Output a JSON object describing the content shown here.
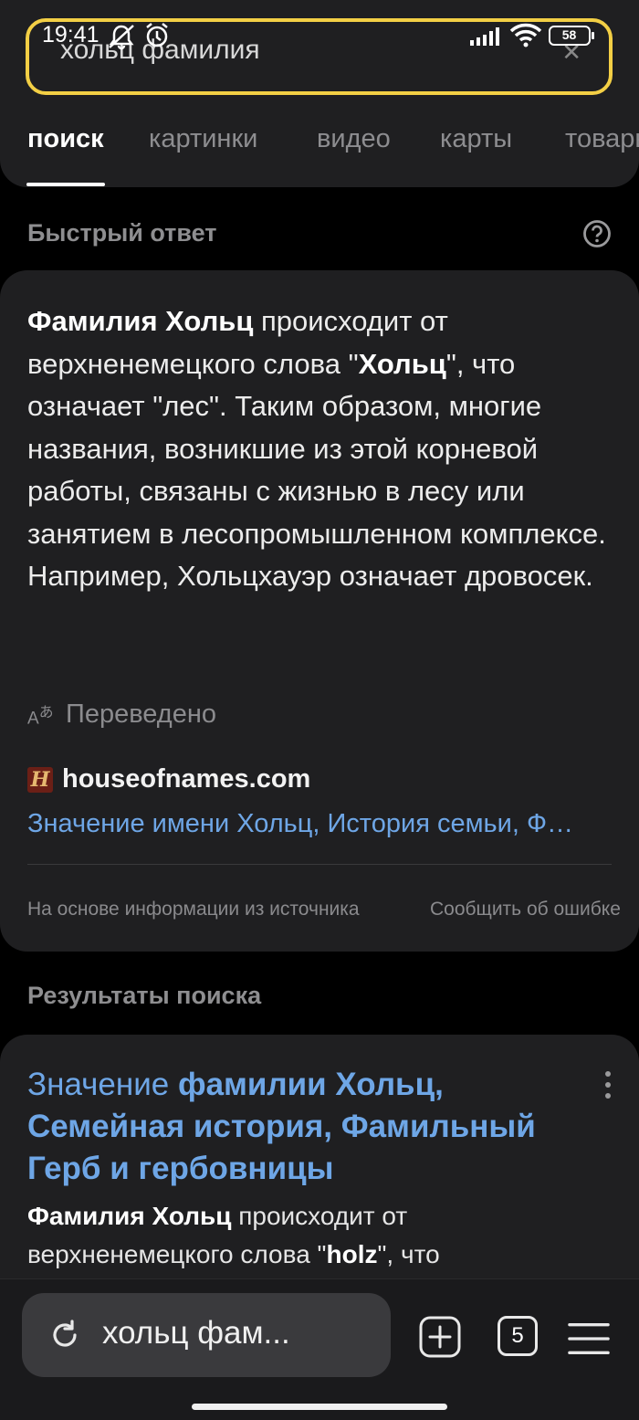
{
  "status_bar": {
    "time": "19:41",
    "battery": "58",
    "icons": [
      "mute-icon",
      "alarm-icon",
      "signal-icon",
      "wifi-icon",
      "battery-icon"
    ]
  },
  "search": {
    "query": "хольц фамилия"
  },
  "tabs": [
    {
      "label": "поиск",
      "active": true
    },
    {
      "label": "картинки"
    },
    {
      "label": "видео"
    },
    {
      "label": "карты"
    },
    {
      "label": "товары"
    }
  ],
  "quick_answer": {
    "title": "Быстрый ответ",
    "text_parts": {
      "p1_bold": "Фамилия Хольц",
      "p1_rest": " происходит от верхненемецкого слова \"",
      "p2_bold": "Хольц",
      "p2_rest": "\", что означает \"лес\". Таким образом, многие названия, возникшие из этой корневой работы, связаны с жизнью в лесу или занятием в лесопромышленном комплексе. Например, Хольцхауэр означает дровосек."
    },
    "translated_label": "Переведено",
    "source_favicon_letter": "H",
    "source_domain": "houseofnames.com",
    "source_link": "Значение имени Хольц, История семьи, Ф…",
    "footer_left": "На основе информации из источника",
    "footer_right": "Сообщить об ошибке"
  },
  "results": {
    "title": "Результаты поиска",
    "items": [
      {
        "title_part1": "Значение ",
        "title_part2": "фамилии Хольц",
        "title_part3": ", Семейная история, Фамильный Герб и гербовницы",
        "snippet_bold1": "Фамилия Хольц",
        "snippet_rest1": " происходит от верхненемецкого слова \"",
        "snippet_bold2": "holz",
        "snippet_rest2": "\", что"
      }
    ]
  },
  "bottom_bar": {
    "url_text": "хольц фам...",
    "tabs_count": "5"
  },
  "colors": {
    "accent_yellow": "#f3cf45",
    "link_blue": "#6ea6e6",
    "card_bg": "#1f1f21"
  }
}
